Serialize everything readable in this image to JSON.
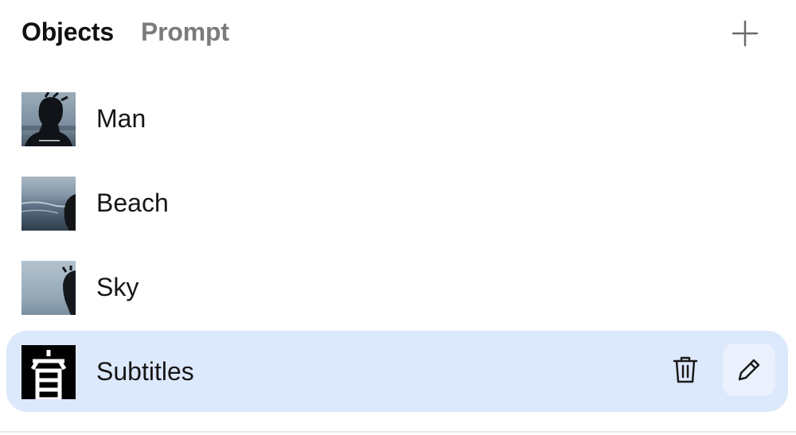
{
  "tabs": [
    {
      "label": "Objects",
      "active": true
    },
    {
      "label": "Prompt",
      "active": false
    }
  ],
  "add_icon": "plus-icon",
  "objects": [
    {
      "label": "Man",
      "thumbnail": "man-silhouette-thumbnail",
      "selected": false
    },
    {
      "label": "Beach",
      "thumbnail": "beach-thumbnail",
      "selected": false
    },
    {
      "label": "Sky",
      "thumbnail": "sky-thumbnail",
      "selected": false
    },
    {
      "label": "Subtitles",
      "thumbnail": "subtitles-thumbnail",
      "selected": true
    }
  ],
  "row_actions": {
    "delete_icon": "trash-icon",
    "edit_icon": "pencil-icon"
  },
  "colors": {
    "selected_row": "#dce8fb",
    "active_tab": "#111111",
    "inactive_tab": "#7b7b7b"
  }
}
